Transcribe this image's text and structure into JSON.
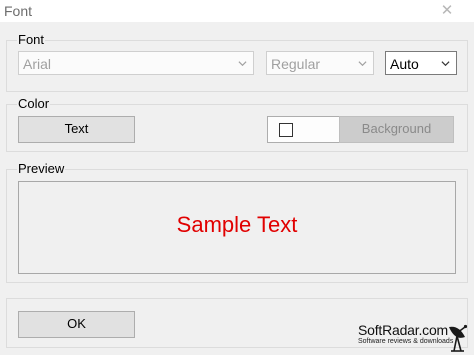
{
  "window": {
    "title": "Font",
    "close_glyph": "✕"
  },
  "font_group": {
    "label": "Font",
    "family": {
      "value": "Arial"
    },
    "style": {
      "value": "Regular"
    },
    "size": {
      "value": "Auto"
    }
  },
  "color_group": {
    "label": "Color",
    "text_button": "Text",
    "background_button": "Background"
  },
  "preview_group": {
    "label": "Preview",
    "sample_text": "Sample Text",
    "sample_color": "#e10000"
  },
  "footer": {
    "ok_button": "OK"
  },
  "watermark": {
    "brand": "SoftRadar.com",
    "tagline": "Software reviews & downloads",
    "icon": "satellite-dish-icon"
  }
}
